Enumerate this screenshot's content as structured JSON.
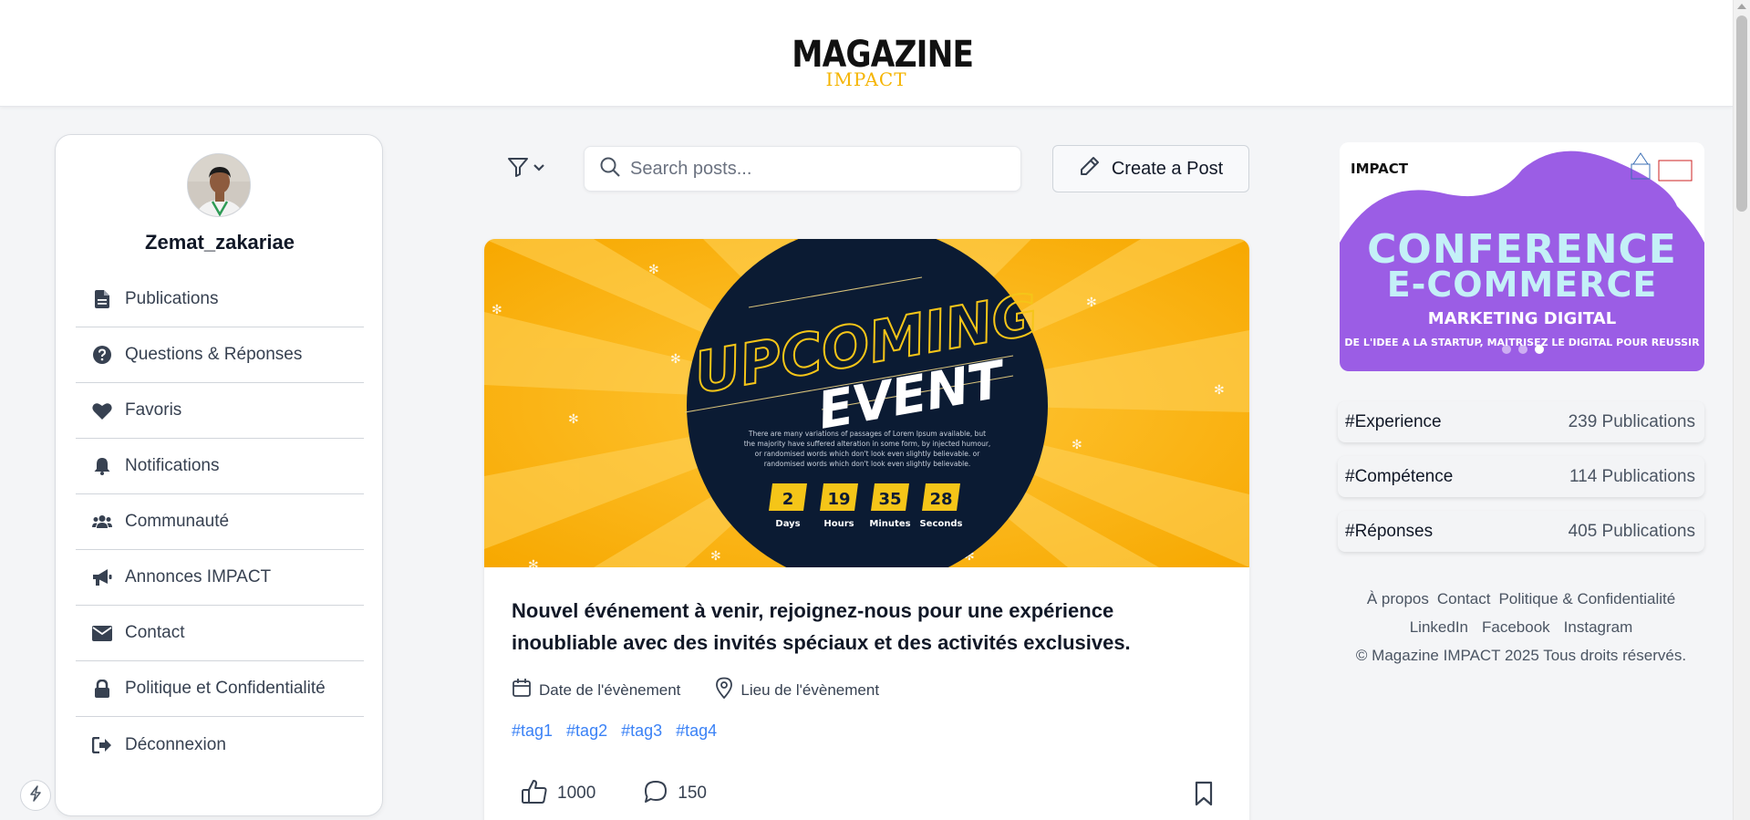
{
  "header": {
    "logo_main": "MAGAZINE",
    "logo_sub": "IMPACT"
  },
  "profile": {
    "username": "Zemat_zakariae"
  },
  "sidebar": {
    "items": [
      {
        "label": "Publications",
        "icon": "file-icon"
      },
      {
        "label": "Questions & Réponses",
        "icon": "question-circle-icon"
      },
      {
        "label": "Favoris",
        "icon": "heart-icon"
      },
      {
        "label": "Notifications",
        "icon": "bell-icon"
      },
      {
        "label": "Communauté",
        "icon": "users-icon"
      },
      {
        "label": "Annonces IMPACT",
        "icon": "megaphone-icon"
      },
      {
        "label": "Contact",
        "icon": "envelope-icon"
      },
      {
        "label": "Politique et Confidentialité",
        "icon": "lock-icon"
      },
      {
        "label": "Déconnexion",
        "icon": "sign-out-icon"
      }
    ]
  },
  "toolbar": {
    "search_placeholder": "Search posts...",
    "create_label": "Create a Post"
  },
  "post": {
    "image": {
      "headline1": "UPCOMING",
      "headline2": "EVENT",
      "body_lines": [
        "There are many variations of passages of Lorem Ipsum available, but",
        "the majority have suffered alteration in some form, by injected humour,",
        "or randomised words which don't look even slightly believable. or",
        "randomised words which don't look even slightly believable."
      ],
      "countdown": [
        {
          "value": "2",
          "unit": "Days"
        },
        {
          "value": "19",
          "unit": "Hours"
        },
        {
          "value": "35",
          "unit": "Minutes"
        },
        {
          "value": "28",
          "unit": "Seconds"
        }
      ]
    },
    "title": "Nouvel événement à venir, rejoignez-nous pour une expérience inoubliable avec des invités spéciaux et des activités exclusives.",
    "date_label": "Date de l'évènement",
    "location_label": "Lieu de l'évènement",
    "tags": [
      "#tag1",
      "#tag2",
      "#tag3",
      "#tag4"
    ],
    "likes": "1000",
    "comments": "150"
  },
  "banner": {
    "brand": "IMPACT",
    "line1": "CONFERENCE",
    "line2": "E-COMMERCE",
    "line3": "MARKETING DIGITAL",
    "line4": "DE L'IDEE A LA STARTUP, MAITRISEZ LE DIGITAL POUR REUSSIR",
    "active_slide": 3,
    "slide_count": 3
  },
  "trending": [
    {
      "name": "#Experience",
      "count": "239 Publications"
    },
    {
      "name": "#Compétence",
      "count": "114 Publications"
    },
    {
      "name": "#Réponses",
      "count": "405 Publications"
    }
  ],
  "footer": {
    "links_row1": [
      "À propos",
      "Contact",
      "Politique & Confidentialité"
    ],
    "links_row2": [
      "LinkedIn",
      "Facebook",
      "Instagram"
    ],
    "copyright": "© Magazine IMPACT 2025 Tous droits réservés."
  },
  "colors": {
    "accent_gold": "#f5b400",
    "event_navy": "#0b1b33",
    "banner_purple": "#9b5de5",
    "tag_blue": "#3b82f6"
  }
}
